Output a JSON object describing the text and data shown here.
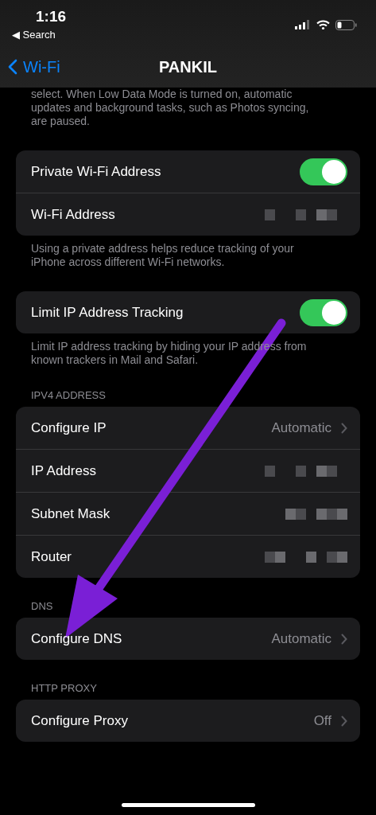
{
  "status_bar": {
    "time": "1:16",
    "back_app": "◀ Search"
  },
  "nav": {
    "back": "Wi-Fi",
    "title": "PANKIL"
  },
  "intro_footer": [
    "select. When Low Data Mode is turned on, automatic",
    "updates and background tasks, such as Photos syncing,",
    "are paused."
  ],
  "sections": [
    {
      "rows": [
        {
          "kind": "toggle",
          "label": "Private Wi-Fi Address",
          "on": true
        },
        {
          "kind": "redacted",
          "label": "Wi-Fi Address"
        }
      ],
      "footer": "Using a private address helps reduce tracking of your iPhone across different Wi-Fi networks."
    },
    {
      "rows": [
        {
          "kind": "toggle",
          "label": "Limit IP Address Tracking",
          "on": true
        }
      ],
      "footer": "Limit IP address tracking by hiding your IP address from known trackers in Mail and Safari."
    },
    {
      "header": "IPV4 ADDRESS",
      "rows": [
        {
          "kind": "value",
          "label": "Configure IP",
          "value": "Automatic"
        },
        {
          "kind": "redacted",
          "label": "IP Address"
        },
        {
          "kind": "redacted",
          "label": "Subnet Mask"
        },
        {
          "kind": "redacted",
          "label": "Router"
        }
      ]
    },
    {
      "header": "DNS",
      "rows": [
        {
          "kind": "value",
          "label": "Configure DNS",
          "value": "Automatic"
        }
      ]
    },
    {
      "header": "HTTP PROXY",
      "rows": [
        {
          "kind": "value",
          "label": "Configure Proxy",
          "value": "Off"
        }
      ]
    }
  ],
  "annotation": {
    "kind": "arrow"
  }
}
